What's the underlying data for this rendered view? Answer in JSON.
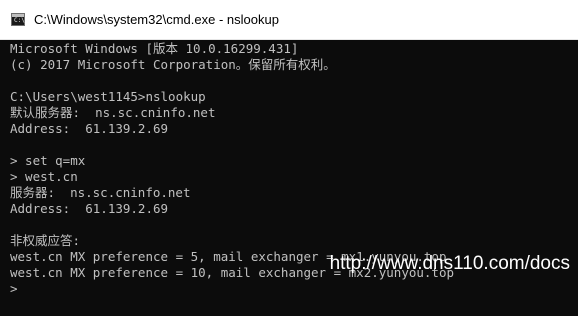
{
  "window": {
    "title": "C:\\Windows\\system32\\cmd.exe - nslookup",
    "icon": "cmd-icon",
    "icon_prompt": "C:\\"
  },
  "colors": {
    "console_bg": "#0c0c0c",
    "console_text": "#c0c0c0",
    "titlebar_bg": "#ffffff"
  },
  "console": {
    "lines": [
      "Microsoft Windows [版本 10.0.16299.431]",
      "(c) 2017 Microsoft Corporation。保留所有权利。",
      "",
      "C:\\Users\\west1145>nslookup",
      "默认服务器:  ns.sc.cninfo.net",
      "Address:  61.139.2.69",
      "",
      "> set q=mx",
      "> west.cn",
      "服务器:  ns.sc.cninfo.net",
      "Address:  61.139.2.69",
      "",
      "非权威应答:",
      "west.cn MX preference = 5, mail exchanger = mx1.yunyou.top",
      "west.cn MX preference = 10, mail exchanger = mx2.yunyou.top",
      ">"
    ]
  },
  "watermark": "http://www.dns110.com/docs"
}
